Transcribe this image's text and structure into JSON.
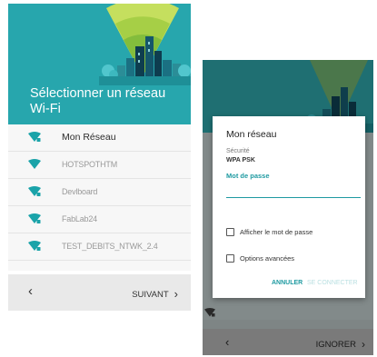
{
  "left_screen": {
    "title": "Sélectionner un réseau Wi-Fi",
    "networks": [
      {
        "name": "Mon Réseau"
      },
      {
        "name": "HOTSPOTHTM"
      },
      {
        "name": "Devlboard"
      },
      {
        "name": "FabLab24"
      },
      {
        "name": "TEST_DEBITS_NTWK_2.4"
      }
    ],
    "footer": {
      "back_icon": "‹",
      "next_label": "SUIVANT",
      "next_icon": "›"
    }
  },
  "right_screen": {
    "dialog": {
      "title": "Mon réseau",
      "security_label": "Sécurité",
      "security_value": "WPA PSK",
      "password_label": "Mot de passe",
      "password_value": "",
      "show_password_label": "Afficher le mot de passe",
      "advanced_options_label": "Options avancées",
      "cancel_label": "ANNULER",
      "connect_label": "SE CONNECTER"
    },
    "footer": {
      "back_icon": "‹",
      "ignore_label": "IGNORER",
      "ignore_icon": "›"
    }
  },
  "colors": {
    "accent": "#1e9aa1",
    "header_teal": "#27a6ad",
    "wifi_icon": "#1aa3a9",
    "dim_header": "#1f6f72"
  }
}
